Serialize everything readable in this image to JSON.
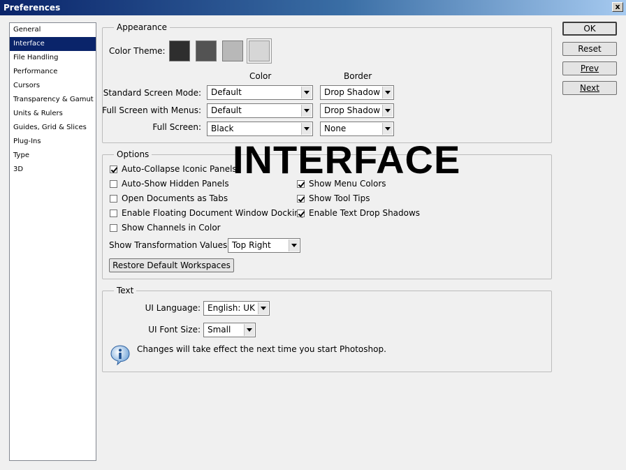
{
  "window": {
    "title": "Preferences",
    "close_glyph": "x"
  },
  "nav": {
    "items": [
      {
        "label": "General",
        "selected": false
      },
      {
        "label": "Interface",
        "selected": true
      },
      {
        "label": "File Handling",
        "selected": false
      },
      {
        "label": "Performance",
        "selected": false
      },
      {
        "label": "Cursors",
        "selected": false
      },
      {
        "label": "Transparency & Gamut",
        "selected": false
      },
      {
        "label": "Units & Rulers",
        "selected": false
      },
      {
        "label": "Guides, Grid & Slices",
        "selected": false
      },
      {
        "label": "Plug-Ins",
        "selected": false
      },
      {
        "label": "Type",
        "selected": false
      },
      {
        "label": "3D",
        "selected": false
      }
    ]
  },
  "buttons": {
    "ok": "OK",
    "reset": "Reset",
    "prev": "Prev",
    "next": "Next"
  },
  "appearance": {
    "legend": "Appearance",
    "color_theme_label": "Color Theme:",
    "themes": [
      "#2e2e2e",
      "#535353",
      "#b8b8b8",
      "#d6d6d6"
    ],
    "selected_theme": 3,
    "col_color": "Color",
    "col_border": "Border",
    "rows": [
      {
        "label": "Standard Screen Mode:",
        "color": "Default",
        "border": "Drop Shadow"
      },
      {
        "label": "Full Screen with Menus:",
        "color": "Default",
        "border": "Drop Shadow"
      },
      {
        "label": "Full Screen:",
        "color": "Black",
        "border": "None"
      }
    ]
  },
  "overlay_label": "INTERFACE",
  "options": {
    "legend": "Options",
    "left": [
      {
        "label": "Auto-Collapse Iconic Panels",
        "checked": true
      },
      {
        "label": "Auto-Show Hidden Panels",
        "checked": false
      },
      {
        "label": "Open Documents as Tabs",
        "checked": false
      },
      {
        "label": "Enable Floating Document Window Docking",
        "checked": false
      },
      {
        "label": "Show Channels in Color",
        "checked": false
      }
    ],
    "right": [
      {
        "label": "Show Menu Colors",
        "checked": true
      },
      {
        "label": "Show Tool Tips",
        "checked": true
      },
      {
        "label": "Enable Text Drop Shadows",
        "checked": true
      }
    ],
    "transform_label": "Show Transformation Values:",
    "transform_value": "Top Right",
    "restore_button": "Restore Default Workspaces"
  },
  "text": {
    "legend": "Text",
    "language_label": "UI Language:",
    "language_value": "English: UK",
    "font_size_label": "UI Font Size:",
    "font_size_value": "Small",
    "info": "Changes will take effect the next time you start Photoshop.",
    "info_icon": "info-icon"
  }
}
